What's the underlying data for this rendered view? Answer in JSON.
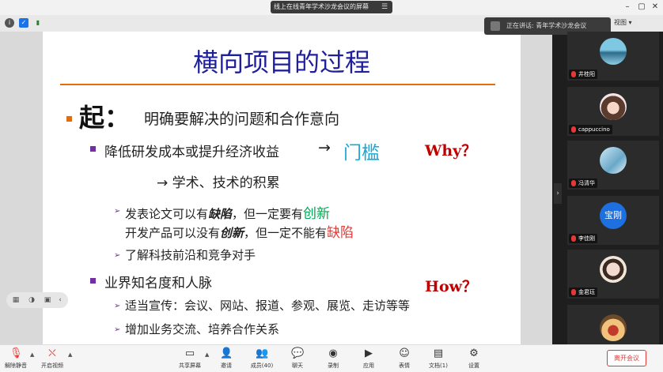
{
  "window": {
    "title": "线上在线青年学术沙龙会议的屏幕",
    "menu_glyph": "☰",
    "minimize": "–",
    "maximize": "▢",
    "close": "✕"
  },
  "speaking": {
    "text": "正在讲话: 青年学术沙龙会议",
    "view_label": "视图"
  },
  "slide": {
    "title": "横向项目的过程",
    "qi": "起：",
    "qi_text": "明确要解决的问题和合作意向",
    "line1": "降低研发成本或提升经济收益",
    "arrow": "→",
    "menkan": "门槛",
    "why": "Why？",
    "line2": "→  学术、技术的积累",
    "sub1a_1": "发表论文可以有",
    "sub1a_2": "缺陷",
    "sub1a_3": "，但一定要有",
    "sub1a_4": "创新",
    "sub1b_1": "开发产品可以没有",
    "sub1b_2": "创新",
    "sub1b_3": "，但一定不能有",
    "sub1b_4": "缺陷",
    "sub2": "了解科技前沿和竞争对手",
    "line3": "业界知名度和人脉",
    "how": "How？",
    "sub3": "适当宣传：会议、网站、报道、参观、展览、走访等等",
    "sub4": "增加业务交流、培养合作关系"
  },
  "participants": [
    {
      "name": "井桂阳"
    },
    {
      "name": "cappuccino"
    },
    {
      "name": "冯清华"
    },
    {
      "name": "李佳刚",
      "avatar_text": "宝刚"
    },
    {
      "name": "金君珏"
    },
    {
      "name": ""
    }
  ],
  "toolbar": {
    "unmute": "解除静音",
    "video": "开启视频",
    "share": "共享屏幕",
    "invite": "邀请",
    "members": "成员(40)",
    "chat": "聊天",
    "record": "录制",
    "apps": "应用",
    "emoji": "表情",
    "docs": "文档(1)",
    "settings": "设置",
    "leave": "离开会议"
  },
  "colors": {
    "title_blue": "#1f1f9c",
    "rule_orange": "#e46c0a",
    "bullet_orange": "#e46c0a",
    "bullet_purple": "#7030a0",
    "menkan_cyan": "#1aa7d6",
    "why_red": "#c00000",
    "green": "#00a651",
    "red": "#e53935"
  }
}
